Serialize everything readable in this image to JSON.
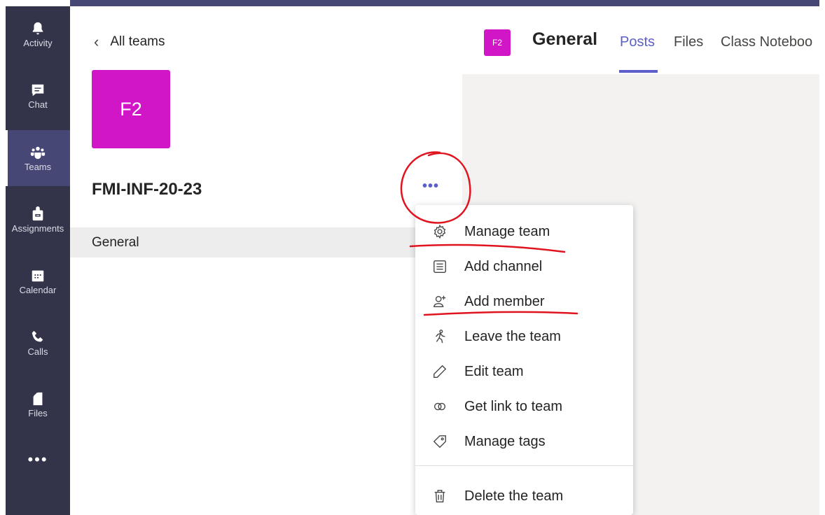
{
  "rail": {
    "items": [
      {
        "label": "Activity",
        "icon": "bell-icon"
      },
      {
        "label": "Chat",
        "icon": "chat-icon"
      },
      {
        "label": "Teams",
        "icon": "teams-icon"
      },
      {
        "label": "Assignments",
        "icon": "assignments-icon"
      },
      {
        "label": "Calendar",
        "icon": "calendar-icon"
      },
      {
        "label": "Calls",
        "icon": "phone-icon"
      },
      {
        "label": "Files",
        "icon": "file-icon"
      }
    ],
    "more": "•••"
  },
  "panel": {
    "back_label": "All teams",
    "team_initials": "F2",
    "team_name": "FMI-INF-20-23",
    "more_label": "•••",
    "channel": "General"
  },
  "header": {
    "initials": "F2",
    "title": "General",
    "tabs": [
      {
        "label": "Posts",
        "active": true
      },
      {
        "label": "Files",
        "active": false
      },
      {
        "label": "Class Noteboo",
        "active": false
      }
    ]
  },
  "menu": {
    "items": [
      {
        "label": "Manage team",
        "icon": "gear-icon"
      },
      {
        "label": "Add channel",
        "icon": "channel-list-icon"
      },
      {
        "label": "Add member",
        "icon": "add-person-icon"
      },
      {
        "label": "Leave the team",
        "icon": "leave-icon"
      },
      {
        "label": "Edit team",
        "icon": "pencil-icon"
      },
      {
        "label": "Get link to team",
        "icon": "link-icon"
      },
      {
        "label": "Manage tags",
        "icon": "tag-icon"
      },
      {
        "label": "Delete the team",
        "icon": "trash-icon"
      }
    ]
  },
  "colors": {
    "rail": "#33344a",
    "rail_active": "#464775",
    "accent": "#5b5fc7",
    "team_avatar": "#d116c7",
    "annotation": "#e0141e"
  }
}
